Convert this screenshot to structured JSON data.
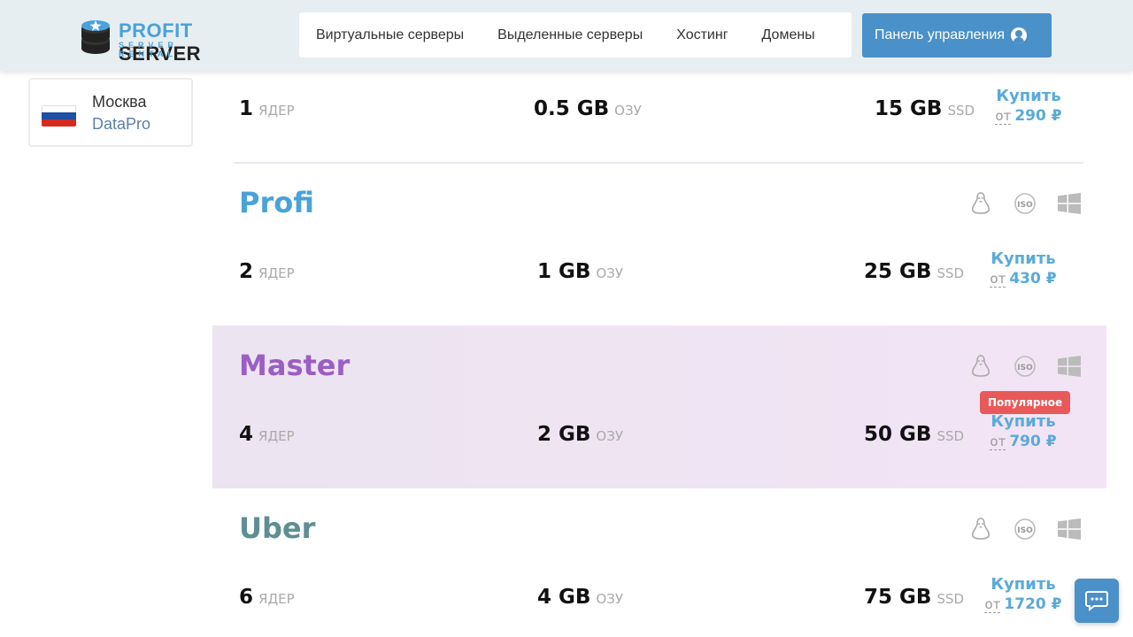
{
  "header": {
    "logo": {
      "word1": "PROFIT",
      "word2": "SERVER",
      "tagline": "SERVER RENTAL"
    },
    "nav": [
      "Виртуальные серверы",
      "Выделенные серверы",
      "Хостинг",
      "Домены"
    ],
    "panel_button": "Панель управления"
  },
  "location": {
    "city": "Москва",
    "datacenter": "DataPro",
    "flag_colors": [
      "#ffffff",
      "#1f4ea3",
      "#d52b1e"
    ]
  },
  "labels": {
    "cores_unit": "ЯДЕР",
    "ram_unit": "ОЗУ",
    "disk_unit": "SSD",
    "buy": "Купить",
    "from": "от",
    "currency": "₽",
    "popular": "Популярное"
  },
  "plans": [
    {
      "name": "",
      "cores": "1",
      "ram": "0.5 GB",
      "disk": "15 GB",
      "price": "290",
      "color": "#4aa2d8"
    },
    {
      "name": "Profi",
      "cores": "2",
      "ram": "1 GB",
      "disk": "25 GB",
      "price": "430",
      "color": "#4aa2d8"
    },
    {
      "name": "Master",
      "cores": "4",
      "ram": "2 GB",
      "disk": "50 GB",
      "price": "790",
      "color": "#9b5ec4",
      "popular": true
    },
    {
      "name": "Uber",
      "cores": "6",
      "ram": "4 GB",
      "disk": "75 GB",
      "price": "1720",
      "color": "#5e8f92"
    }
  ],
  "colors": {
    "accent": "#4a90c9",
    "link": "#5aaad8",
    "badge": "#e85a5a"
  }
}
